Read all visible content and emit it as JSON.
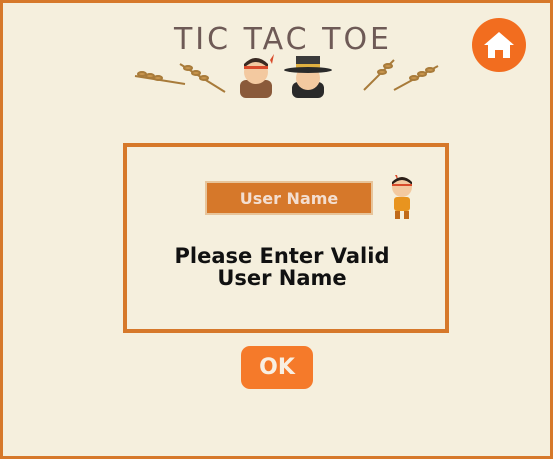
{
  "header": {
    "title": "TIC TAC TOE"
  },
  "dialog": {
    "username_placeholder": "User Name",
    "error_message": "Please Enter Valid User Name"
  },
  "actions": {
    "ok_label": "OK"
  },
  "icons": {
    "home": "home-icon",
    "wheat": "wheat-icon",
    "pilgrim": "pilgrim-icon",
    "native": "native-child-icon"
  },
  "colors": {
    "background": "#f5efdd",
    "border": "#d6782a",
    "accent": "#f26d1f",
    "title": "#6e5a56"
  }
}
